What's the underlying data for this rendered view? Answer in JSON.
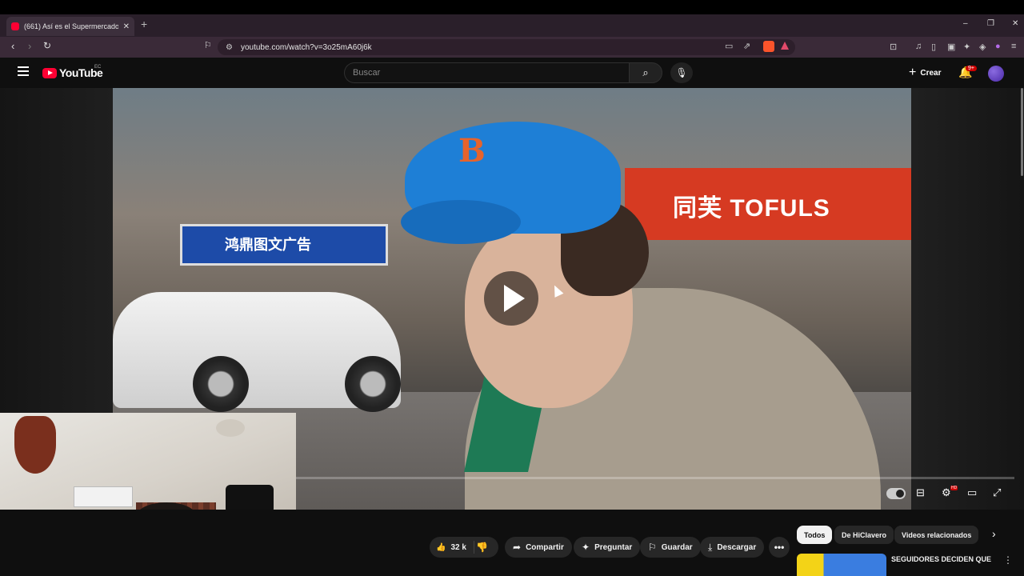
{
  "browser": {
    "tab_title": "(661) Así es el Supermercado de",
    "tab_close": "✕",
    "new_tab": "+",
    "window_controls": {
      "minimize": "–",
      "restore": "❐",
      "close": "✕"
    },
    "url": "youtube.com/watch?v=3o25mA60j6k"
  },
  "youtube": {
    "logo_text": "YouTube",
    "region_code": "EC",
    "search_placeholder": "Buscar",
    "create_label": "Crear",
    "notification_badge": "9+"
  },
  "video": {
    "sign_red_text": "同芙 TOFULS",
    "sign_blue_text": "鸿鼎图文广告",
    "cap_logo": "B"
  },
  "actions": {
    "like_count": "32 k",
    "share_label": "Compartir",
    "ask_label": "Preguntar",
    "save_label": "Guardar",
    "download_label": "Descargar",
    "more_label": "•••"
  },
  "chips": [
    {
      "label": "Todos",
      "active": true
    },
    {
      "label": "De HiClavero",
      "active": false
    },
    {
      "label": "Videos relacionados",
      "active": false
    }
  ],
  "suggested": {
    "title": "SEGUIDORES DECIDEN QUE"
  },
  "colors": {
    "youtube_red": "#ff0033",
    "background": "#0f0f0f",
    "pill_bg": "#272727"
  }
}
